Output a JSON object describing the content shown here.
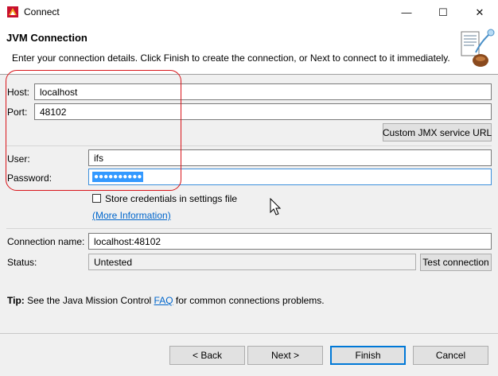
{
  "window": {
    "title": "Connect",
    "minimize_glyph": "—",
    "maximize_glyph": "☐",
    "close_glyph": "✕"
  },
  "header": {
    "title": "JVM Connection",
    "description": "Enter your connection details. Click Finish to create the connection, or Next to connect to it immediately."
  },
  "form": {
    "host_label": "Host:",
    "host_value": "localhost",
    "port_label": "Port:",
    "port_value": "48102",
    "custom_jmx_button": "Custom JMX service URL",
    "user_label": "User:",
    "user_value": "ifs",
    "password_label": "Password:",
    "password_value": "●●●●●●●●●●",
    "store_credentials_label": "Store credentials in settings file",
    "store_credentials_checked": false,
    "more_info_link": "(More Information)",
    "connection_name_label": "Connection name:",
    "connection_name_value": "localhost:48102",
    "status_label": "Status:",
    "status_value": "Untested",
    "test_connection_button": "Test connection"
  },
  "tip": {
    "prefix": "Tip:",
    "text_before": " See the Java Mission Control ",
    "link": "FAQ",
    "text_after": " for common connections problems."
  },
  "buttons": {
    "back": "< Back",
    "next": "Next >",
    "finish": "Finish",
    "cancel": "Cancel"
  },
  "colors": {
    "annotation_outline": "#d9151a",
    "link": "#0066cc",
    "selection": "#3399ff"
  },
  "icons": {
    "app": "jmc-app-icon",
    "wizard": "connection-wizard-icon",
    "cursor": "mouse-pointer-icon"
  }
}
